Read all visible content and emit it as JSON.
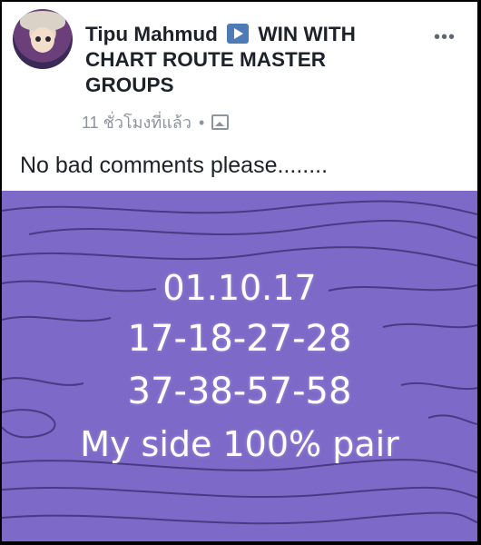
{
  "post": {
    "author": "Tipu Mahmud",
    "group_title": "WIN WITH CHART ROUTE MASTER GROUPS",
    "time": "11 ชั่วโมงที่แล้ว",
    "separator": "•",
    "more": "•••",
    "caption": "No bad comments please........"
  },
  "image_text": {
    "line1": "01.10.17",
    "line2": "17-18-27-28",
    "line3": "37-38-57-58",
    "line4": "My side  100% pair"
  },
  "colors": {
    "image_bg": "#7c69c8",
    "icon_blue": "#4e7ab6"
  }
}
